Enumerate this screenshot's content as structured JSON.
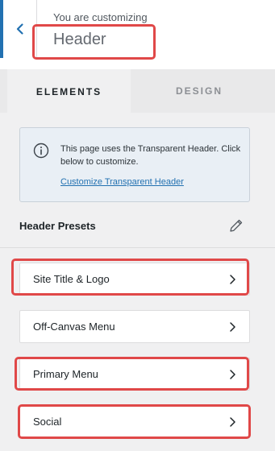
{
  "header": {
    "caption": "You are customizing",
    "title": "Header"
  },
  "tabs": [
    {
      "label": "ELEMENTS",
      "active": true
    },
    {
      "label": "DESIGN",
      "active": false
    }
  ],
  "notice": {
    "text": "This page uses the Transparent Header. Click below to customize.",
    "link": "Customize Transparent Header"
  },
  "presets": {
    "label": "Header Presets"
  },
  "items": [
    {
      "label": "Site Title & Logo"
    },
    {
      "label": "Off-Canvas Menu"
    },
    {
      "label": "Primary Menu"
    },
    {
      "label": "Social"
    }
  ],
  "colors": {
    "accent": "#2271b1",
    "highlight": "#e04848"
  },
  "icons": {
    "back": "chevron-left-icon",
    "info": "info-icon",
    "edit": "pencil-icon",
    "chevron": "chevron-right-icon"
  }
}
